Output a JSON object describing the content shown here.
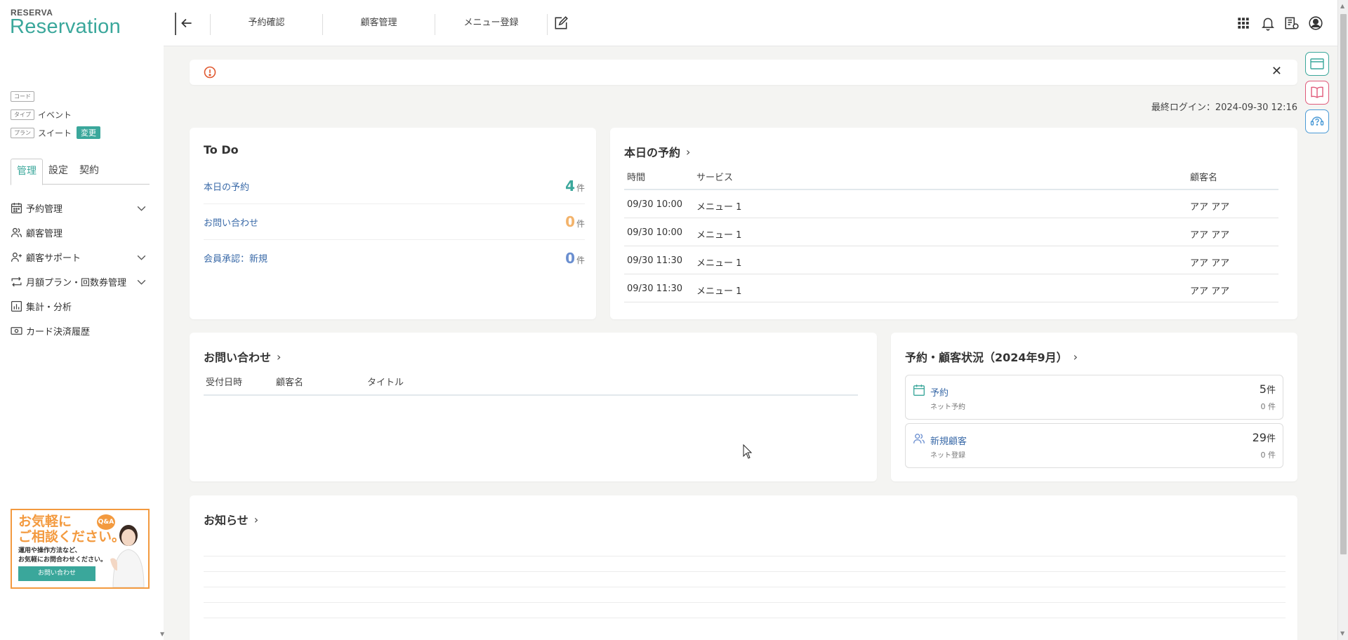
{
  "brand": {
    "small": "RESERVA",
    "big": "Reservation"
  },
  "meta": {
    "code_tag": "コード",
    "type_tag": "タイプ",
    "type_value": "イベント",
    "plan_tag": "プラン",
    "plan_value": "スイート",
    "change_label": "変更"
  },
  "sidebar": {
    "tabs": [
      "管理",
      "設定",
      "契約"
    ],
    "items": [
      {
        "label": "予約管理",
        "icon": "calendar-icon",
        "expandable": true
      },
      {
        "label": "顧客管理",
        "icon": "users-icon",
        "expandable": false
      },
      {
        "label": "顧客サポート",
        "icon": "user-plus-icon",
        "expandable": true
      },
      {
        "label": "月額プラン・回数券管理",
        "icon": "repeat-icon",
        "expandable": true
      },
      {
        "label": "集計・分析",
        "icon": "bar-chart-icon",
        "expandable": false
      },
      {
        "label": "カード決済履歴",
        "icon": "card-icon",
        "expandable": false
      }
    ],
    "banner": {
      "line1": "お気軽に",
      "line2": "ご相談ください。",
      "desc1": "運用や操作方法など、",
      "desc2": "お気軽にお問合わせください。",
      "button": "お問い合わせ",
      "badge": "Q&A"
    }
  },
  "topbar": {
    "nav": [
      "予約確認",
      "顧客管理",
      "メニュー登録"
    ]
  },
  "last_login": "最終ログイン：2024-09-30 12:16",
  "todo": {
    "title": "To Do",
    "rows": [
      {
        "label": "本日の予約",
        "count": "4",
        "unit": "件",
        "color": "#3aa79b"
      },
      {
        "label": "お問い合わせ",
        "count": "0",
        "unit": "件",
        "color": "#f3b36b"
      },
      {
        "label": "会員承認：新規",
        "count": "0",
        "unit": "件",
        "color": "#6b8fd0"
      }
    ]
  },
  "today": {
    "title": "本日の予約",
    "headers": [
      "時間",
      "サービス",
      "顧客名"
    ],
    "rows": [
      {
        "time": "09/30 10:00",
        "service": "メニュー 1",
        "customer": "アア アア"
      },
      {
        "time": "09/30 10:00",
        "service": "メニュー 1",
        "customer": "アア アア"
      },
      {
        "time": "09/30 11:30",
        "service": "メニュー 1",
        "customer": "アア アア"
      },
      {
        "time": "09/30 11:30",
        "service": "メニュー 1",
        "customer": "アア アア"
      }
    ]
  },
  "inquiry": {
    "title": "お問い合わせ",
    "headers": [
      "受付日時",
      "顧客名",
      "タイトル"
    ]
  },
  "status": {
    "title": "予約・顧客状況（2024年9月）",
    "boxes": [
      {
        "label": "予約",
        "sub": "ネット予約",
        "count": "5",
        "unit": "件",
        "sub_count": "0",
        "sub_unit": "件"
      },
      {
        "label": "新規顧客",
        "sub": "ネット登録",
        "count": "29",
        "unit": "件",
        "sub_count": "0",
        "sub_unit": "件"
      }
    ]
  },
  "notice": {
    "title": "お知らせ"
  }
}
